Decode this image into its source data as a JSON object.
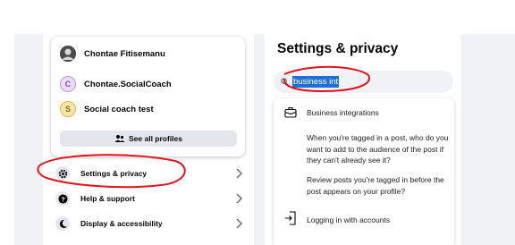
{
  "profiles": {
    "items": [
      {
        "name": "Chontae Fitisemanu",
        "avatar_letter": ""
      },
      {
        "name": "Chontae.SocialCoach",
        "avatar_letter": "C"
      },
      {
        "name": "Social coach test",
        "avatar_letter": "S"
      }
    ],
    "see_all_label": "See all profiles"
  },
  "menu": {
    "items": [
      {
        "label": "Settings & privacy",
        "icon": "gear-icon"
      },
      {
        "label": "Help & support",
        "icon": "question-icon"
      },
      {
        "label": "Display & accessibility",
        "icon": "moon-icon"
      }
    ]
  },
  "settings": {
    "title": "Settings & privacy",
    "search_value": "business int",
    "results": [
      {
        "text": "Business integrations",
        "icon": "briefcase-icon"
      },
      {
        "text": "When you're tagged in a post, who do you want to add to the audience of the post if they can't already see it?",
        "icon": ""
      },
      {
        "text": "Review posts you're tagged in before the post appears on your profile?",
        "icon": ""
      },
      {
        "text": "Logging in with accounts",
        "icon": "login-icon"
      }
    ]
  },
  "colors": {
    "annotation_red": "#e0141e",
    "selection_blue": "#1f6fd6",
    "chip_gray": "#e4e6eb"
  }
}
